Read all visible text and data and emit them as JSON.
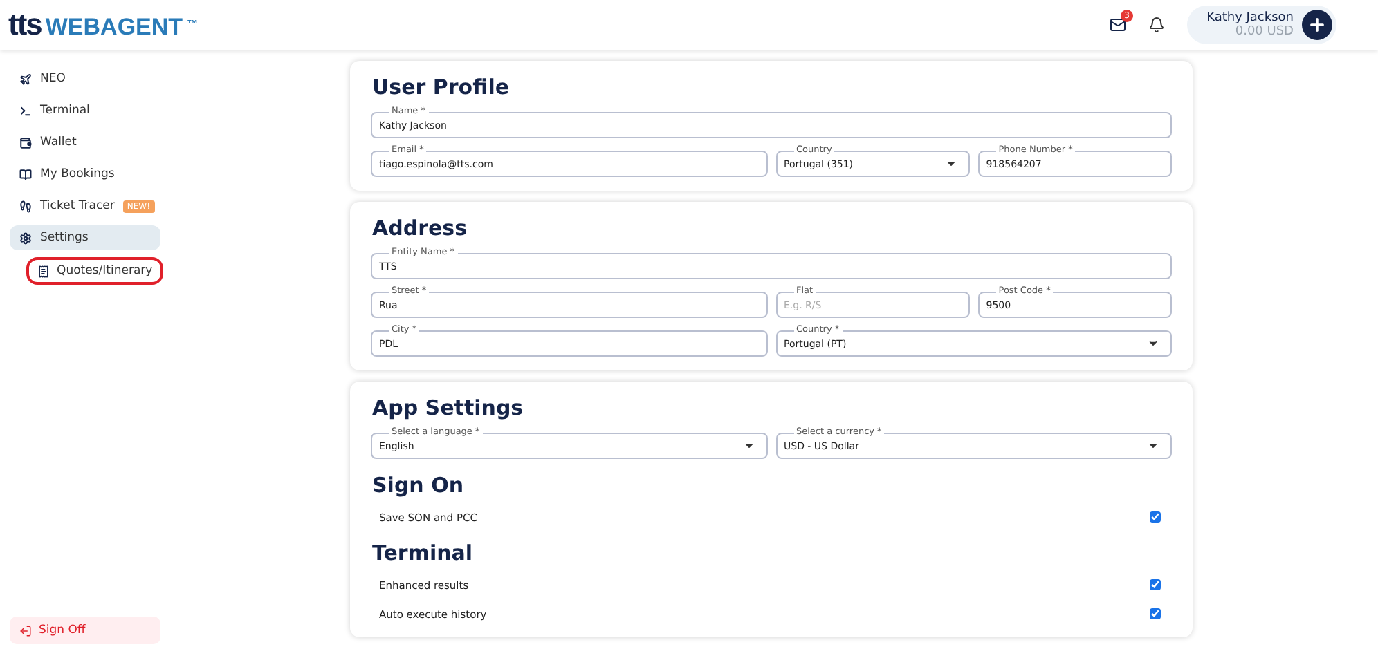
{
  "header": {
    "logo_prefix": "tts",
    "logo_main": "WEBAGENT",
    "logo_mark": "™",
    "messages_badge": "3",
    "user": {
      "name": "Kathy Jackson",
      "balance": "0.00 USD"
    }
  },
  "sidebar": {
    "items": [
      {
        "label": "NEO",
        "selected": false
      },
      {
        "label": "Terminal",
        "selected": false
      },
      {
        "label": "Wallet",
        "selected": false
      },
      {
        "label": "My Bookings",
        "selected": false
      },
      {
        "label": "Ticket Tracer",
        "selected": false,
        "badge": "NEW!"
      },
      {
        "label": "Settings",
        "selected": true,
        "children": [
          {
            "label": "Quotes/Itinerary",
            "selected": false,
            "highlighted": true
          }
        ]
      }
    ],
    "sign_off": "Sign Off"
  },
  "sections": [
    {
      "title": "User Profile",
      "rows": [
        [
          {
            "label": "Name *",
            "value": "Kathy Jackson",
            "kind": "text"
          }
        ],
        [
          {
            "label": "Email *",
            "value": "tiago.espinola@tts.com",
            "kind": "text"
          },
          {
            "label": "Country",
            "value": "Portugal (351)",
            "kind": "select"
          },
          {
            "label": "Phone Number *",
            "value": "918564207",
            "kind": "text"
          }
        ]
      ]
    },
    {
      "title": "Address",
      "rows": [
        [
          {
            "label": "Entity Name *",
            "value": "TTS",
            "kind": "text"
          }
        ],
        [
          {
            "label": "Street *",
            "value": "Rua",
            "kind": "text"
          },
          {
            "label": "Flat",
            "placeholder": "E.g. R/S",
            "kind": "text"
          },
          {
            "label": "Post Code *",
            "value": "9500",
            "kind": "text"
          }
        ],
        [
          {
            "label": "City *",
            "value": "PDL",
            "kind": "text"
          },
          {
            "label": "Country *",
            "value": "Portugal (PT)",
            "kind": "select"
          }
        ]
      ]
    },
    {
      "title": "App Settings",
      "rows": [
        [
          {
            "label": "Select a language *",
            "value": "English",
            "kind": "select"
          },
          {
            "label": "Select a currency *",
            "value": "USD - US Dollar",
            "kind": "select"
          }
        ]
      ],
      "groups": [
        {
          "title": "Sign On",
          "options": [
            {
              "label": "Save SON and PCC",
              "checked": true
            }
          ]
        },
        {
          "title": "Terminal",
          "options": [
            {
              "label": "Enhanced results",
              "checked": true
            },
            {
              "label": "Auto execute history",
              "checked": true
            }
          ]
        }
      ]
    }
  ]
}
